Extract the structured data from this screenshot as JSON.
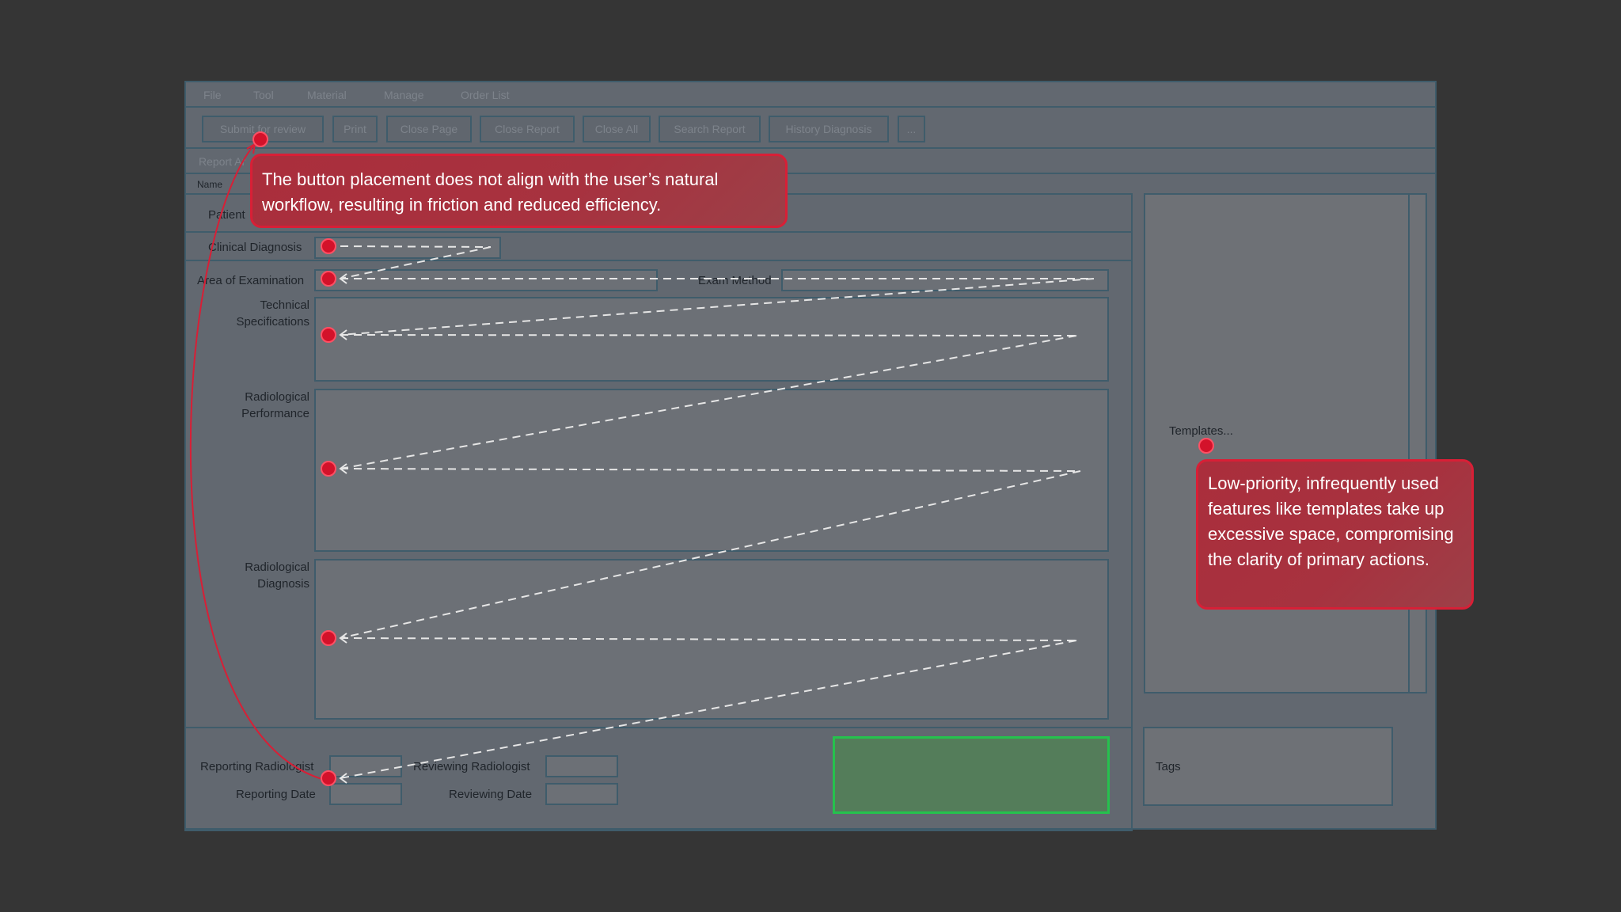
{
  "menu": [
    "File",
    "Tool",
    "Material",
    "Manage",
    "Order List"
  ],
  "toolbar": [
    "Submit for review",
    "Print",
    "Close Page",
    "Close Report",
    "Close All",
    "Search Report",
    "History Diagnosis",
    "..."
  ],
  "report_tab": "Report Ar",
  "name_header": "Name",
  "form": {
    "patient": "Patient",
    "clinical_diagnosis": "Clinical Diagnosis",
    "area_of_examination": "Area of Examination",
    "exam_method": "Exam Method",
    "technical_specifications": "Technical Specifications",
    "radiological_performance": "Radiological Performance",
    "radiological_diagnosis": "Radiological Diagnosis",
    "reporting_radiologist": "Reporting Radiologist",
    "reviewing_radiologist": "Reviewing Radiologist",
    "reporting_date": "Reporting Date",
    "reviewing_date": "Reviewing Date"
  },
  "side": {
    "templates": "Templates...",
    "tags": "Tags"
  },
  "annotations": {
    "top": "The button placement does not align with the user’s natural workflow, resulting in friction and reduced efficiency.",
    "right": "Low-priority, infrequently used features like templates take up excessive space, compromising the clarity of primary actions."
  },
  "colors": {
    "background": "#353535",
    "panel": "#626870",
    "border": "#3f5c6b",
    "annotation_red": "#d81f36",
    "highlight_green": "#25c24d"
  }
}
